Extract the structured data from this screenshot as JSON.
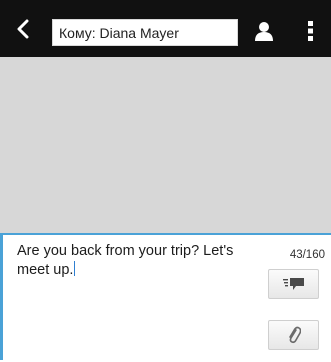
{
  "header": {
    "back_icon": "chevron-left-icon",
    "recipient_field": "Кому: Diana Mayer",
    "contact_icon": "person-icon",
    "menu_icon": "vertical-dots-icon"
  },
  "composer": {
    "message": "Are you back from your trip? Let's meet up.",
    "char_counter": "43/160",
    "send_icon": "send-icon",
    "attach_icon": "paperclip-icon"
  },
  "colors": {
    "topbar": "#111111",
    "thread_bg": "#d7d7d7",
    "accent": "#4aa2d7"
  }
}
